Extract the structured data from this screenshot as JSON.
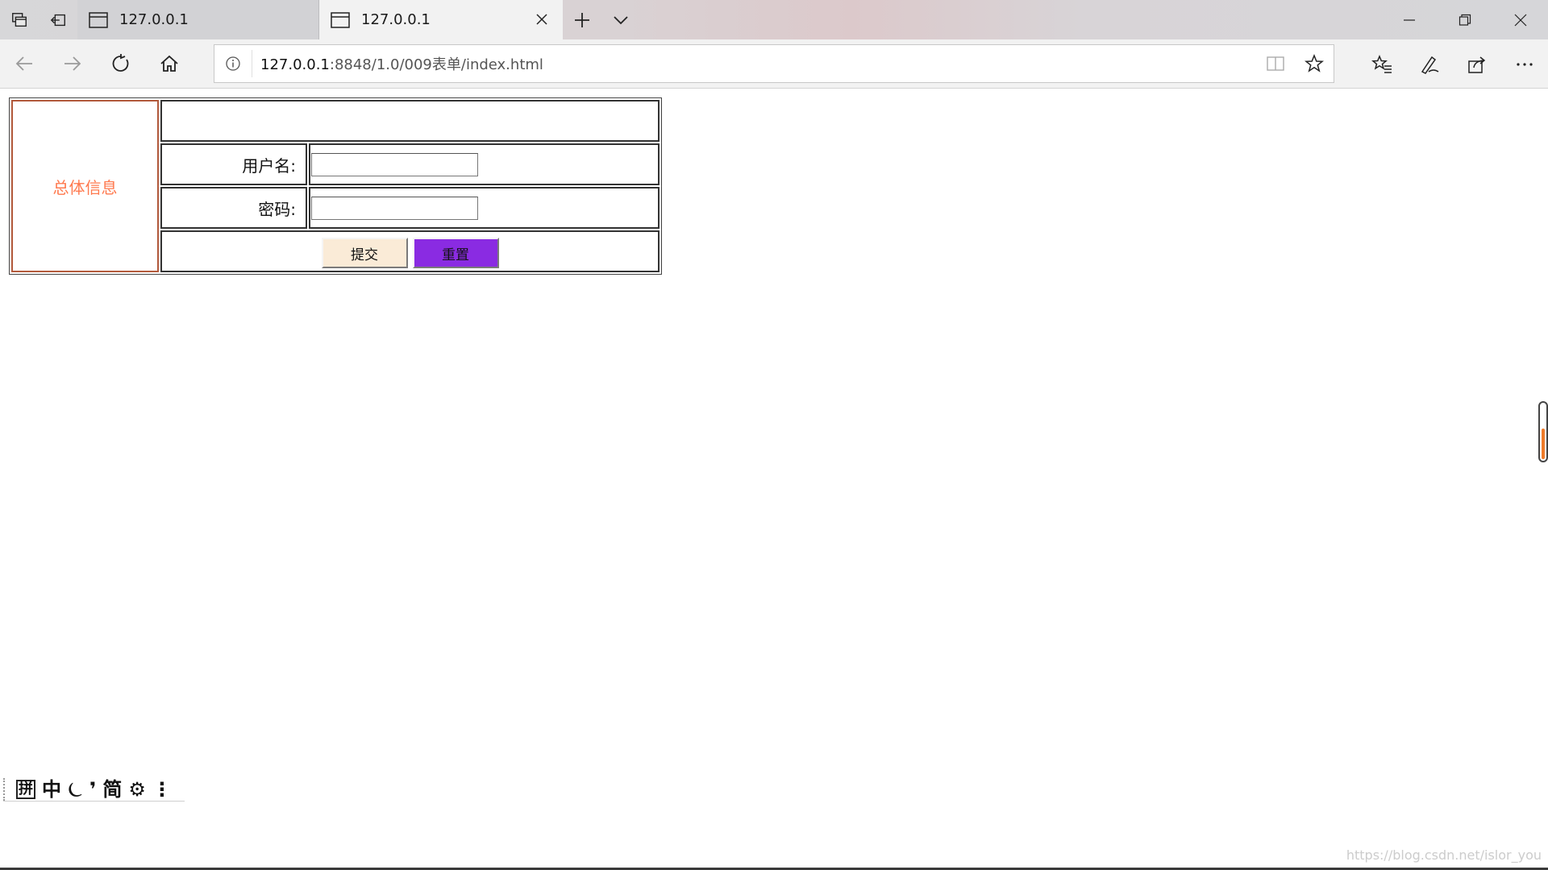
{
  "browser": {
    "tabs": [
      {
        "title": "127.0.0.1",
        "active": false
      },
      {
        "title": "127.0.0.1",
        "active": true
      }
    ],
    "address": {
      "host": "127.0.0.1",
      "path": ":8848/1.0/009表单/index.html"
    }
  },
  "form": {
    "info_label": "总体信息",
    "username_label": "用户名:",
    "password_label": "密码:",
    "username_value": "",
    "password_value": "",
    "submit_label": "提交",
    "reset_label": "重置",
    "colors": {
      "info_text": "#ff7a4f",
      "submit_bg": "#faebd7",
      "reset_bg": "#8a2be2"
    }
  },
  "ime": {
    "items": [
      "拼",
      "中",
      "⏾",
      "❜",
      "简",
      "⚙",
      "⋮"
    ]
  },
  "watermark": "https://blog.csdn.net/islor_you"
}
